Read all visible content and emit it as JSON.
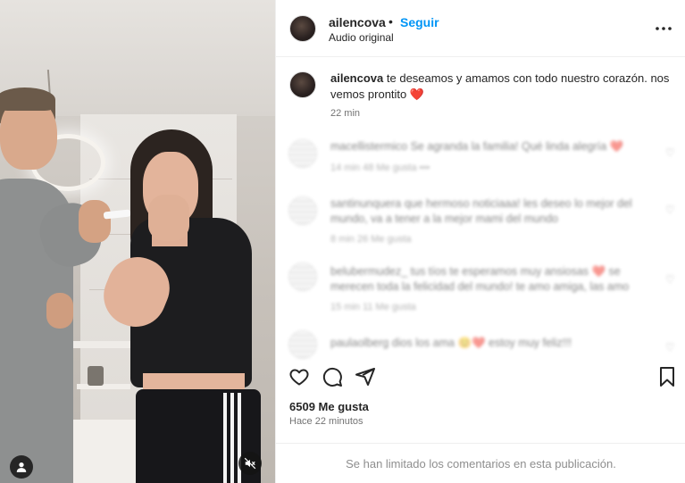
{
  "post": {
    "username": "ailencova",
    "follow_label": "Seguir",
    "separator": "•",
    "audio_label": "Audio original",
    "more_label": "•••"
  },
  "caption": {
    "username": "ailencova",
    "text": "te deseamos y amamos con todo nuestro corazón. nos vemos prontito",
    "emoji": "❤️",
    "time": "22 min"
  },
  "comments": [
    {
      "text": "macellistermico Se agranda la familia! Qué linda alegría ❤️",
      "meta": "14 min    48 Me gusta    •••"
    },
    {
      "text": "santinunquera que hermoso noticiaaa! les deseo lo mejor del mundo, va a tener a la mejor mami del mundo",
      "meta": "8 min    26 Me gusta"
    },
    {
      "text": "belubermudez_ tus tíos te esperamos muy ansiosas ❤️ se merecen toda la felicidad del mundo! te amo amiga, las amo",
      "meta": "15 min    11 Me gusta"
    },
    {
      "text": "paulaolberg dios los ama 😊❤️ estoy muy feliz!!!",
      "meta": ""
    }
  ],
  "stats": {
    "likes": "6509 Me gusta",
    "posted": "Hace 22 minutos"
  },
  "footer": {
    "notice": "Se han limitado los comentarios en esta publicación."
  },
  "icons": {
    "like": "heart-outline-icon",
    "comment": "comment-bubble-icon",
    "share": "paper-plane-icon",
    "save": "bookmark-icon",
    "profile": "user-icon",
    "mute": "speaker-muted-icon"
  },
  "colors": {
    "accent": "#0095f6",
    "heart": "#e0245e",
    "muted_text": "#737373"
  }
}
